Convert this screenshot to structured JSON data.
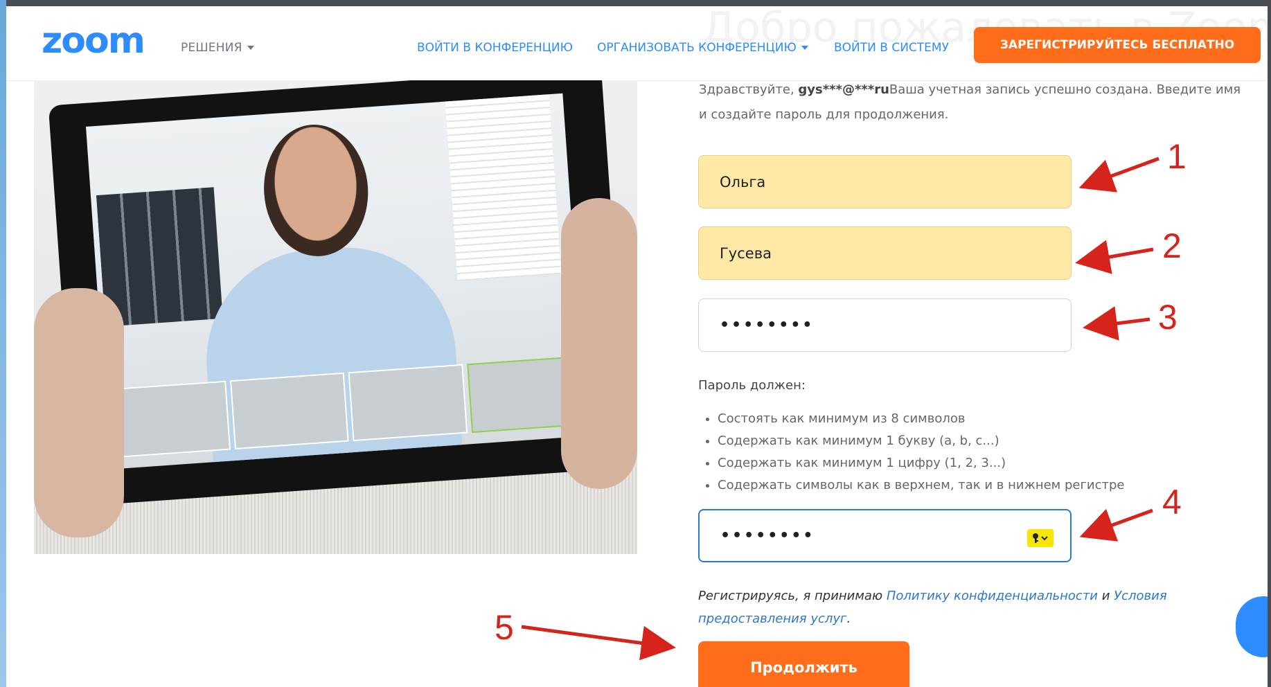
{
  "header": {
    "logo": "zoom",
    "solutions_label": "РЕШЕНИЯ",
    "join_meeting": "ВОЙТИ В КОНФЕРЕНЦИЮ",
    "host_meeting": "ОРГАНИЗОВАТЬ КОНФЕРЕНЦИЮ",
    "sign_in": "ВОЙТИ В СИСТЕМУ",
    "signup": "ЗАРЕГИСТРИРУЙТЕСЬ БЕСПЛАТНО",
    "background_heading": "Добро пожаловать в Zoom"
  },
  "form": {
    "greeting_prefix": "Здравствуйте, ",
    "greeting_email": "gys***@***ru",
    "greeting_rest": "Ваша учетная запись успешно создана. Введите имя и создайте пароль для продолжения.",
    "first_name": "Ольга",
    "last_name": "Гусева",
    "password": "••••••••",
    "confirm_password": "••••••••",
    "requirements_title": "Пароль должен:",
    "requirements": [
      "Состоять как минимум из 8 символов",
      "Содержать как минимум 1 букву (a, b, c...)",
      "Содержать как минимум 1 цифру (1, 2, 3...)",
      "Содержать символы как в верхнем, так и в нижнем регистре"
    ],
    "terms_prefix": "Регистрируясь, я принимаю ",
    "privacy_link": "Политику конфиденциальности",
    "terms_and": " и ",
    "tos_link": "Условия предоставления услуг",
    "terms_suffix": ".",
    "continue": "Продолжить"
  },
  "annotations": [
    "1",
    "2",
    "3",
    "4",
    "5"
  ],
  "colors": {
    "brand_blue": "#2d8cff",
    "accent_orange": "#ff6c1a",
    "autofill_yellow": "#fde9a5",
    "annotation_red": "#d6231c"
  }
}
